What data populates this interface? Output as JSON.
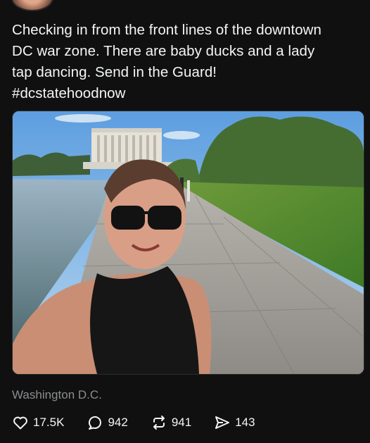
{
  "post": {
    "text_lines": [
      "Checking in from the front lines of the downtown",
      "DC war zone. There are baby ducks and a lady",
      "tap dancing. Send in the Guard!"
    ],
    "hashtag": "#dcstatehoodnow",
    "location": "Washington D.C."
  },
  "actions": {
    "likes": "17.5K",
    "comments": "942",
    "reposts": "941",
    "shares": "143"
  },
  "icons": {
    "like": "heart-icon",
    "comment": "comment-bubble-icon",
    "repost": "repost-icon",
    "share": "share-send-icon"
  },
  "colors": {
    "background": "#101010",
    "text": "#f3f5f7",
    "muted": "#8a8d91"
  }
}
